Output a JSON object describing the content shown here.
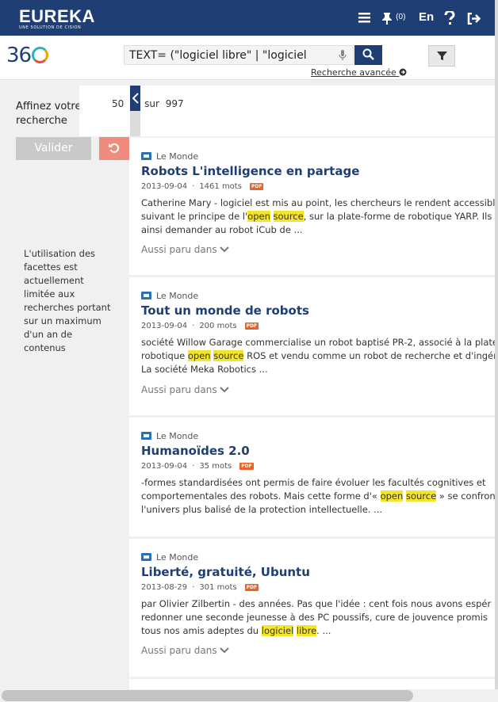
{
  "header": {
    "brand": "EUREKA",
    "brand_sub": "UNE SOLUTION DE CISION",
    "cart_count": "(0)",
    "lang": "En"
  },
  "search": {
    "query": "TEXT= (\"logiciel libre\" | \"logiciel",
    "advanced_label": "Recherche avancée"
  },
  "sidebar": {
    "title": "Affinez votre recherche",
    "valider_label": "Valider",
    "note": "L'utilisation des facettes est actuellement limitée aux recherches portant sur un maximum d'un an de contenus"
  },
  "pagination": {
    "per_page": "50",
    "sur": "sur",
    "total": "997"
  },
  "results": [
    {
      "source": "Le Monde",
      "title": "Robots L'intelligence en partage",
      "date": "2013-09-04",
      "words": "1461 mots",
      "pdf": "PDF",
      "line1": "Catherine Mary - logiciel est mis au point, les chercheurs le rendent accessibl",
      "line2_pre": "suivant le principe de l'",
      "line2_h1": "open",
      "line2_h2": "source",
      "line2_post": ", sur la plate-forme de robotique YARP. Ils",
      "line3": "ainsi demander au robot iCub de ...",
      "aussi": "Aussi paru dans"
    },
    {
      "source": "Le Monde",
      "title": "Tout un monde de robots",
      "date": "2013-09-04",
      "words": "200 mots",
      "pdf": "PDF",
      "line1": "société Willow Garage commercialise un robot baptisé PR-2, associé à la plate",
      "line2_pre": "robotique ",
      "line2_h1": "open",
      "line2_h2": "source",
      "line2_post": " ROS et vendu comme un robot de recherche et d'ingén",
      "line3": "La société Meka Robotics ...",
      "aussi": "Aussi paru dans"
    },
    {
      "source": "Le Monde",
      "title": "Humanoïdes 2.0",
      "date": "2013-09-04",
      "words": "35 mots",
      "pdf": "PDF",
      "line1": "-formes standardisées ont permis de faire évoluer les facultés cognitives et",
      "line2_pre": "comportementales des robots. Mais cette forme d'« ",
      "line2_h1": "open",
      "line2_h2": "source",
      "line2_post": " » se confron",
      "line3": "l'univers plus balisé de la protection intellectuelle. ..."
    },
    {
      "source": "Le Monde",
      "title": "Liberté, gratuité, Ubuntu",
      "date": "2013-08-29",
      "words": "301 mots",
      "pdf": "PDF",
      "line1": "par Olivier Zilbertin - des années. Pas que l'idée : cent fois nous avons espér",
      "line2_pre": "redonner une seconde jeunesse à des PC poussifs, cure de jouvence promis",
      "line2_h1": "",
      "line2_h2": "",
      "line2_post": "",
      "line3_pre": "tous nos amis adeptes du ",
      "line3_h1": "logiciel",
      "line3_h2": "libre",
      "line3_post": ". ...",
      "aussi": "Aussi paru dans"
    }
  ]
}
